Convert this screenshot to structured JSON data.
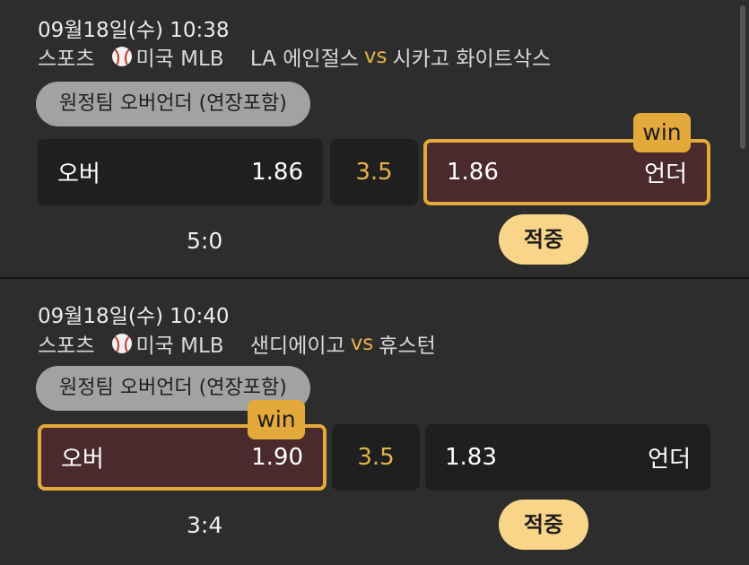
{
  "bets": [
    {
      "datetime": "09월18일(수) 10:38",
      "sport": "스포츠",
      "league": "미국 MLB",
      "home_team": "LA 에인절스",
      "vs": "vs",
      "away_team": "시카고 화이트삭스",
      "market": "원정팀 오버언더 (연장포함)",
      "over_label": "오버",
      "over_odds": "1.86",
      "line": "3.5",
      "under_odds": "1.86",
      "under_label": "언더",
      "win_badge": "win",
      "winning_pick": "under",
      "score": "5:0",
      "result": "적중"
    },
    {
      "datetime": "09월18일(수) 10:40",
      "sport": "스포츠",
      "league": "미국 MLB",
      "home_team": "샌디에이고",
      "vs": "vs",
      "away_team": "휴스턴",
      "market": "원정팀 오버언더 (연장포함)",
      "over_label": "오버",
      "over_odds": "1.90",
      "line": "3.5",
      "under_odds": "1.83",
      "under_label": "언더",
      "win_badge": "win",
      "winning_pick": "over",
      "score": "3:4",
      "result": "적중"
    }
  ],
  "icons": {
    "sport_icon": "baseball-icon"
  },
  "colors": {
    "accent": "#e3a93a",
    "win_bg": "#4a2a2c",
    "hit_badge": "#f8d589"
  }
}
